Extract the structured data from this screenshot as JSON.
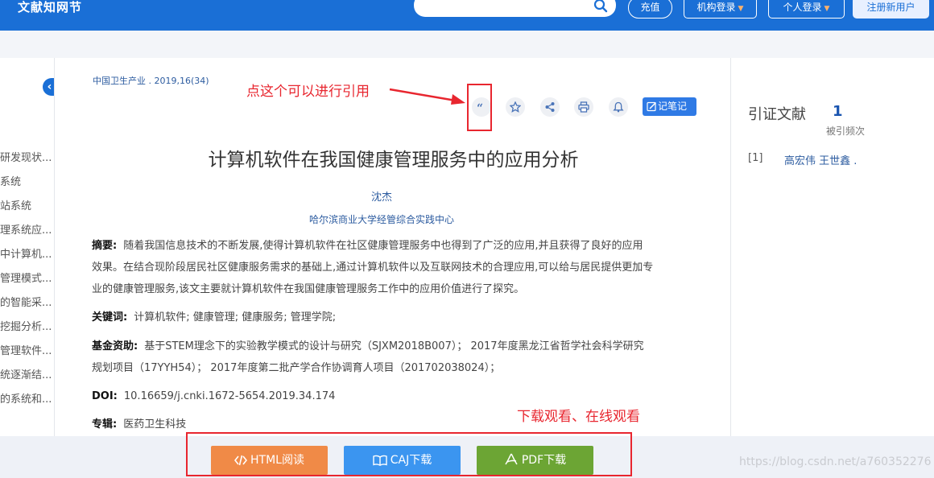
{
  "header": {
    "logo": "文献知网节",
    "recharge_label": "充值",
    "institution_login_label": "机构登录",
    "personal_login_label": "个人登录",
    "register_label": "注册新用户"
  },
  "left_sidebar": {
    "items": [
      "研发现状...",
      "系统",
      "站系统",
      "理系统应...",
      "中计算机...",
      "管理模式...",
      "的智能采...",
      "挖掘分析...",
      "管理软件...",
      "统逐渐结...",
      "的系统和..."
    ]
  },
  "article": {
    "source": "中国卫生产业 . 2019,16(34)",
    "note_label": "记笔记",
    "title": "计算机软件在我国健康管理服务中的应用分析",
    "author": "沈杰",
    "organization": "哈尔滨商业大学经管综合实践中心",
    "abstract_label": "摘要:",
    "abstract_lines": [
      "随着我国信息技术的不断发展,使得计算机软件在社区健康管理服务中也得到了广泛的应用,并且获得了良好的应用",
      "效果。在结合现阶段居民社区健康服务需求的基础上,通过计算机软件以及互联网技术的合理应用,可以给与居民提供更加专",
      "业的健康管理服务,该文主要就计算机软件在我国健康管理服务工作中的应用价值进行了探究。"
    ],
    "keywords_label": "关键词:",
    "keywords": "计算机软件;  健康管理;  健康服务;  管理学院;",
    "fund_label": "基金资助:",
    "fund_lines": [
      "基于STEM理念下的实验教学模式的设计与研究（SJXM2018B007）；  2017年度黑龙江省哲学社会科学研究",
      "规划项目（17YYH54）；  2017年度第二批产学合作协调育人项目（201702038024）；"
    ],
    "doi_label": "DOI:",
    "doi": "10.16659/j.cnki.1672-5654.2019.34.174",
    "special_label": "专辑:",
    "special": "医药卫生科技"
  },
  "right_panel": {
    "title": "引证文献",
    "count": "1",
    "count_label": "被引频次",
    "refs": [
      {
        "index": "[1]",
        "authors": "高宏伟 王世鑫 ."
      }
    ]
  },
  "downloads": {
    "html_label": "HTML阅读",
    "caj_label": "CAJ下载",
    "pdf_label": "PDF下载"
  },
  "annotations": {
    "cite_note": "点这个可以进行引用",
    "download_note": "下载观看、在线观看"
  },
  "watermark": "https://blog.csdn.net/a760352276",
  "colors": {
    "header": "#1a6fd6",
    "annotation_red": "#e8262f",
    "html_btn": "#f08a47",
    "caj_btn": "#3b95f0",
    "pdf_btn": "#6ca534"
  },
  "icons": [
    "search-icon",
    "quote-icon",
    "star-icon",
    "share-icon",
    "print-icon",
    "bell-icon",
    "edit-icon",
    "code-icon",
    "book-icon",
    "pdf-icon",
    "chevron-left-icon",
    "chevron-right-icon"
  ]
}
